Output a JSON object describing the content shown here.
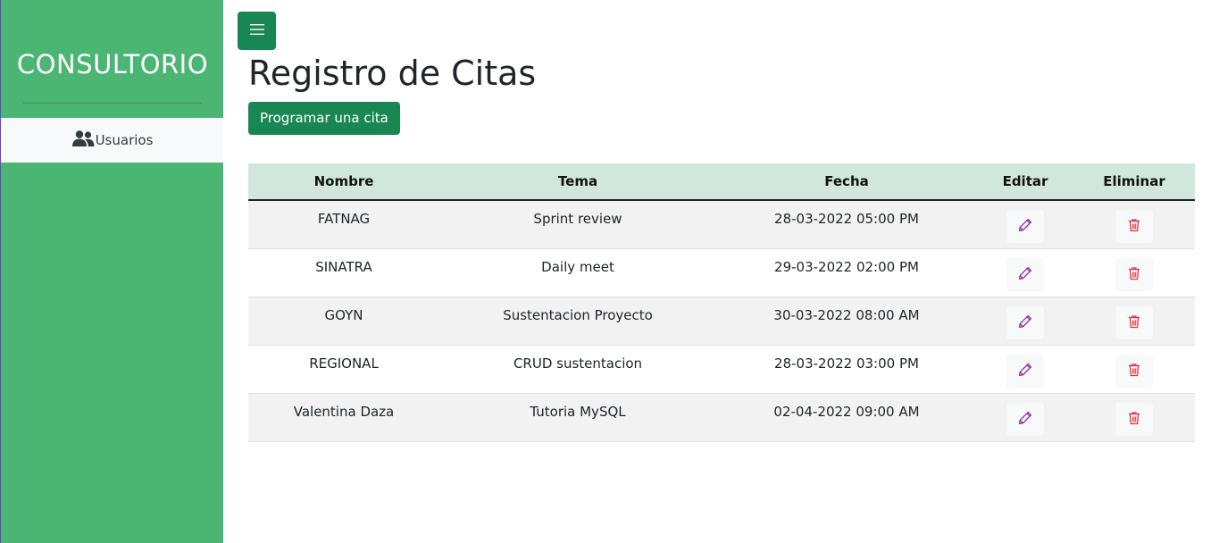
{
  "sidebar": {
    "brand": "CONSULTORIO",
    "items": [
      {
        "label": "Usuarios",
        "icon": "users-icon"
      }
    ],
    "background": "#4bb674"
  },
  "header": {
    "menu_icon": "hamburger-menu-icon",
    "title": "Registro de Citas",
    "primary_button": "Programar una cita"
  },
  "table": {
    "columns": [
      "Nombre",
      "Tema",
      "Fecha",
      "Editar",
      "Eliminar"
    ],
    "rows": [
      {
        "nombre": "FATNAG",
        "tema": "Sprint review",
        "fecha": "28-03-2022 05:00 PM"
      },
      {
        "nombre": "SINATRA",
        "tema": "Daily meet",
        "fecha": "29-03-2022 02:00 PM"
      },
      {
        "nombre": "GOYN",
        "tema": "Sustentacion Proyecto",
        "fecha": "30-03-2022 08:00 AM"
      },
      {
        "nombre": "REGIONAL",
        "tema": "CRUD sustentacion",
        "fecha": "28-03-2022 03:00 PM"
      },
      {
        "nombre": "Valentina Daza",
        "tema": "Tutoria MySQL",
        "fecha": "02-04-2022 09:00 AM"
      }
    ],
    "edit_icon": "pencil-icon",
    "delete_icon": "trash-icon"
  },
  "colors": {
    "accent": "#198754",
    "header_row": "#d1e7dd",
    "edit_icon": "#8a1ea0",
    "delete_icon": "#dc3545"
  }
}
